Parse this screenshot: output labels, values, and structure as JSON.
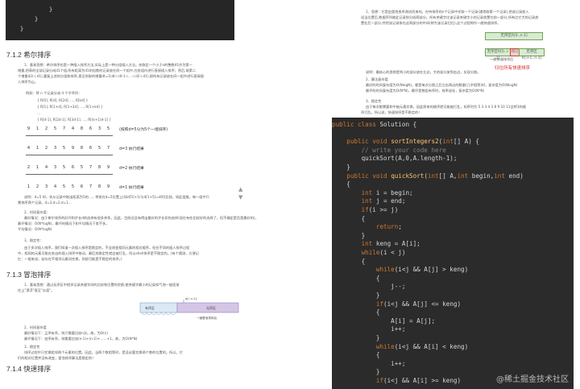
{
  "left": {
    "top_code": [
      "}",
      "}",
      "}"
    ],
    "sec_712": "7.1.2 希尔排序",
    "sec_712_para": [
      "1、基本思想：希尔排序也是一种插入排序方法,实际上是一种分组插入方法。先取定一个小于n的整数d1作为第一",
      "增量,把表的全部记录分成d1个组,所有距离为d1的倍数的记录放在同一个组中,在各组内进行直接插入排序；然后,取第二",
      "个增量d2(＜d1),重复上述的分组和排序,直至所取的增量dt=1(dt＜dt-1＜…＜d2＜d1),即所有记录放在同一组中进行直接插",
      "入排序为止。"
    ],
    "example_label": "例如：将 n 个记录分成 d 个子序列：",
    "example_rows": [
      "{ R[0],    R[d],     R[2d],   …,    R[kd] }",
      "{ R[1],    R[1+d],   R[1+2d], …,    R[1+kd] }",
      "…",
      "{ R[d-1], R[2d-1], R[3d-1], …, R[(k+1)d-1] }"
    ],
    "seq_rows": [
      [
        "9",
        "1",
        "2",
        "5",
        "7",
        "4",
        "8",
        "6",
        "3",
        "5"
      ],
      [
        "4",
        "1",
        "2",
        "3",
        "5",
        "9",
        "8",
        "6",
        "5",
        "7"
      ],
      [
        "2",
        "1",
        "4",
        "3",
        "5",
        "6",
        "5",
        "7",
        "8",
        "9"
      ],
      [
        "1",
        "2",
        "3",
        "4",
        "5",
        "5",
        "6",
        "7",
        "8",
        "9"
      ]
    ],
    "seq_notes": [
      "(按照d=5分为5个一组排序)",
      "d=3 执行结果",
      "d=2 执行结果",
      "d=1 执行结果"
    ],
    "shell_para": [
      "说明：d=5 时，先从记录中取出距离为5的…，将排在d=5位置上(如d[5]+1)与d[1+5]=d[6]比较，如此类推，每一组中只",
      "需排序两个记录。d=3,d=2,d=1…"
    ],
    "time_title": "2、时间复杂度：",
    "time_lines": [
      "最好情况：由于希尔排序的好坏和步长d的选择有很多关系，因此，目前还没有得出最好的步长如何选择(现在有些比较好的选择了，但不确定是否是最好的)，所以，不知道最好的情况下的算法时间复杂度。",
      "最坏情况：O(N*logN)，最坏的情况下和平均情况下差不多。",
      "平均情况：O(N*logN)"
    ],
    "stable_title": "3、稳定性：",
    "stable_lines": [
      "由于多次插入排序，我们知道一次插入排序是稳定的，不会改变相同元素的相对顺序，但在不同的插入排序过程",
      "中，相同的元素可能在各自的插入排序中移动，最后其稳定性就会被打乱，所以shell排序是不稳定的。(有个猜测，方便记",
      "忆：一般来说，若存在不相邻元素间交换，则很可能是不稳定的排序。)"
    ],
    "sec_713": "7.1.3 冒泡排序",
    "bubble_para": [
      "1、基本思想：通过无序区中相邻记录关键字间的比较和位置的交换,使关键字最小的记录如气泡一般逐渐",
      "往上\"漂浮\"直至\"水面\"。"
    ],
    "bubble_fig_labels": [
      "有序区",
      "无序区",
      "a[i..n-1]",
      "一趟冒泡排序后"
    ],
    "bubble_time_title": "2、时间复杂度",
    "bubble_time_lines": [
      "最好情况下：正序有序，则只需要比较n次。故，为O(n)",
      "最坏情况下：逆序有序，则需要比较(n-1)+(n-2)+……+1，故，为O(N*N)"
    ],
    "bubble_stable_title": "3、稳定性",
    "bubble_stable_lines": [
      "排序过程中只交换相邻两个元素的位置。因此，当两个数相等时，是没必要交换两个数的位置的。所以，它",
      "们的相对位置并没有改变，冒泡排序算法是稳定的！"
    ],
    "sec_714": "7.1.4 快速排序"
  },
  "right": {
    "intro_lines": [
      "1、思想：它是由冒泡排序改进而来的。在待排序的n个记录中任取一个记录(通常取第一个记录),把该记录放入",
      "适当位置后,数据序列被此记录划分成两部分。所有关键字比该记录关键字小的记录放置在前一部分,所有比它大的记录放",
      "置在后一部分,并把该记录排在这两部分的中间(称为该记录归位),这个过程称作一趟快速排序。"
    ],
    "qs_fig_labels": [
      "无序区R[0..n-1]",
      "无序区R[0..i-1]",
      "R[i]",
      "无序区R[i+1..n-1]",
      "一趟快速排序后",
      "归位所有快速排序"
    ],
    "qs_note": "说明：最核心的思想是将小的部分放在左边，大的部分放到右边，实现分割。",
    "qs_time_title": "2、算法复杂度",
    "qs_time_lines": [
      "最好的时间复杂度为O(NlogN)，都是每次分割之后左右两边的数量(几乎相等)时，复杂度为O(NlogN)",
      "最坏的时间复杂度为O(N*N)，最坏是数组有序时，效率退化，复杂度为O(N*N)"
    ],
    "qs_stable_title": "3、稳定性",
    "qs_stable_lines": [
      "由于每次都需要和中轴元素交换，因此原来的顺序就可能被打乱，如序列为 5 3 3 4 3 8 9 10 11会将3的顺",
      "序打乱，所以说，快速排序是不稳定的！"
    ],
    "code": [
      "public class Solution {",
      "",
      "    public void sortIntegers2(int[] A) {",
      "        // write your code here",
      "        quickSort(A,0,A.length-1);",
      "    }",
      "    public void quickSort(int[] A,int begin,int end)",
      "    {",
      "        int i = begin;",
      "        int j = end;",
      "        if(i >= j)",
      "        {",
      "            return;",
      "        }",
      "        int keng = A[i];",
      "        while(i < j)",
      "        {",
      "            while(i<j && A[j] > keng)",
      "            {",
      "                j--;",
      "            }",
      "            if(i<j && A[j] <= keng)",
      "            {",
      "                A[i] = A[j];",
      "                i++;",
      "            }",
      "            while(i<j && A[i] < keng)",
      "            {",
      "                i++;",
      "            }",
      "            if(i<j && A[i] >= keng)"
    ],
    "watermark": "@稀土掘金技术社区"
  }
}
